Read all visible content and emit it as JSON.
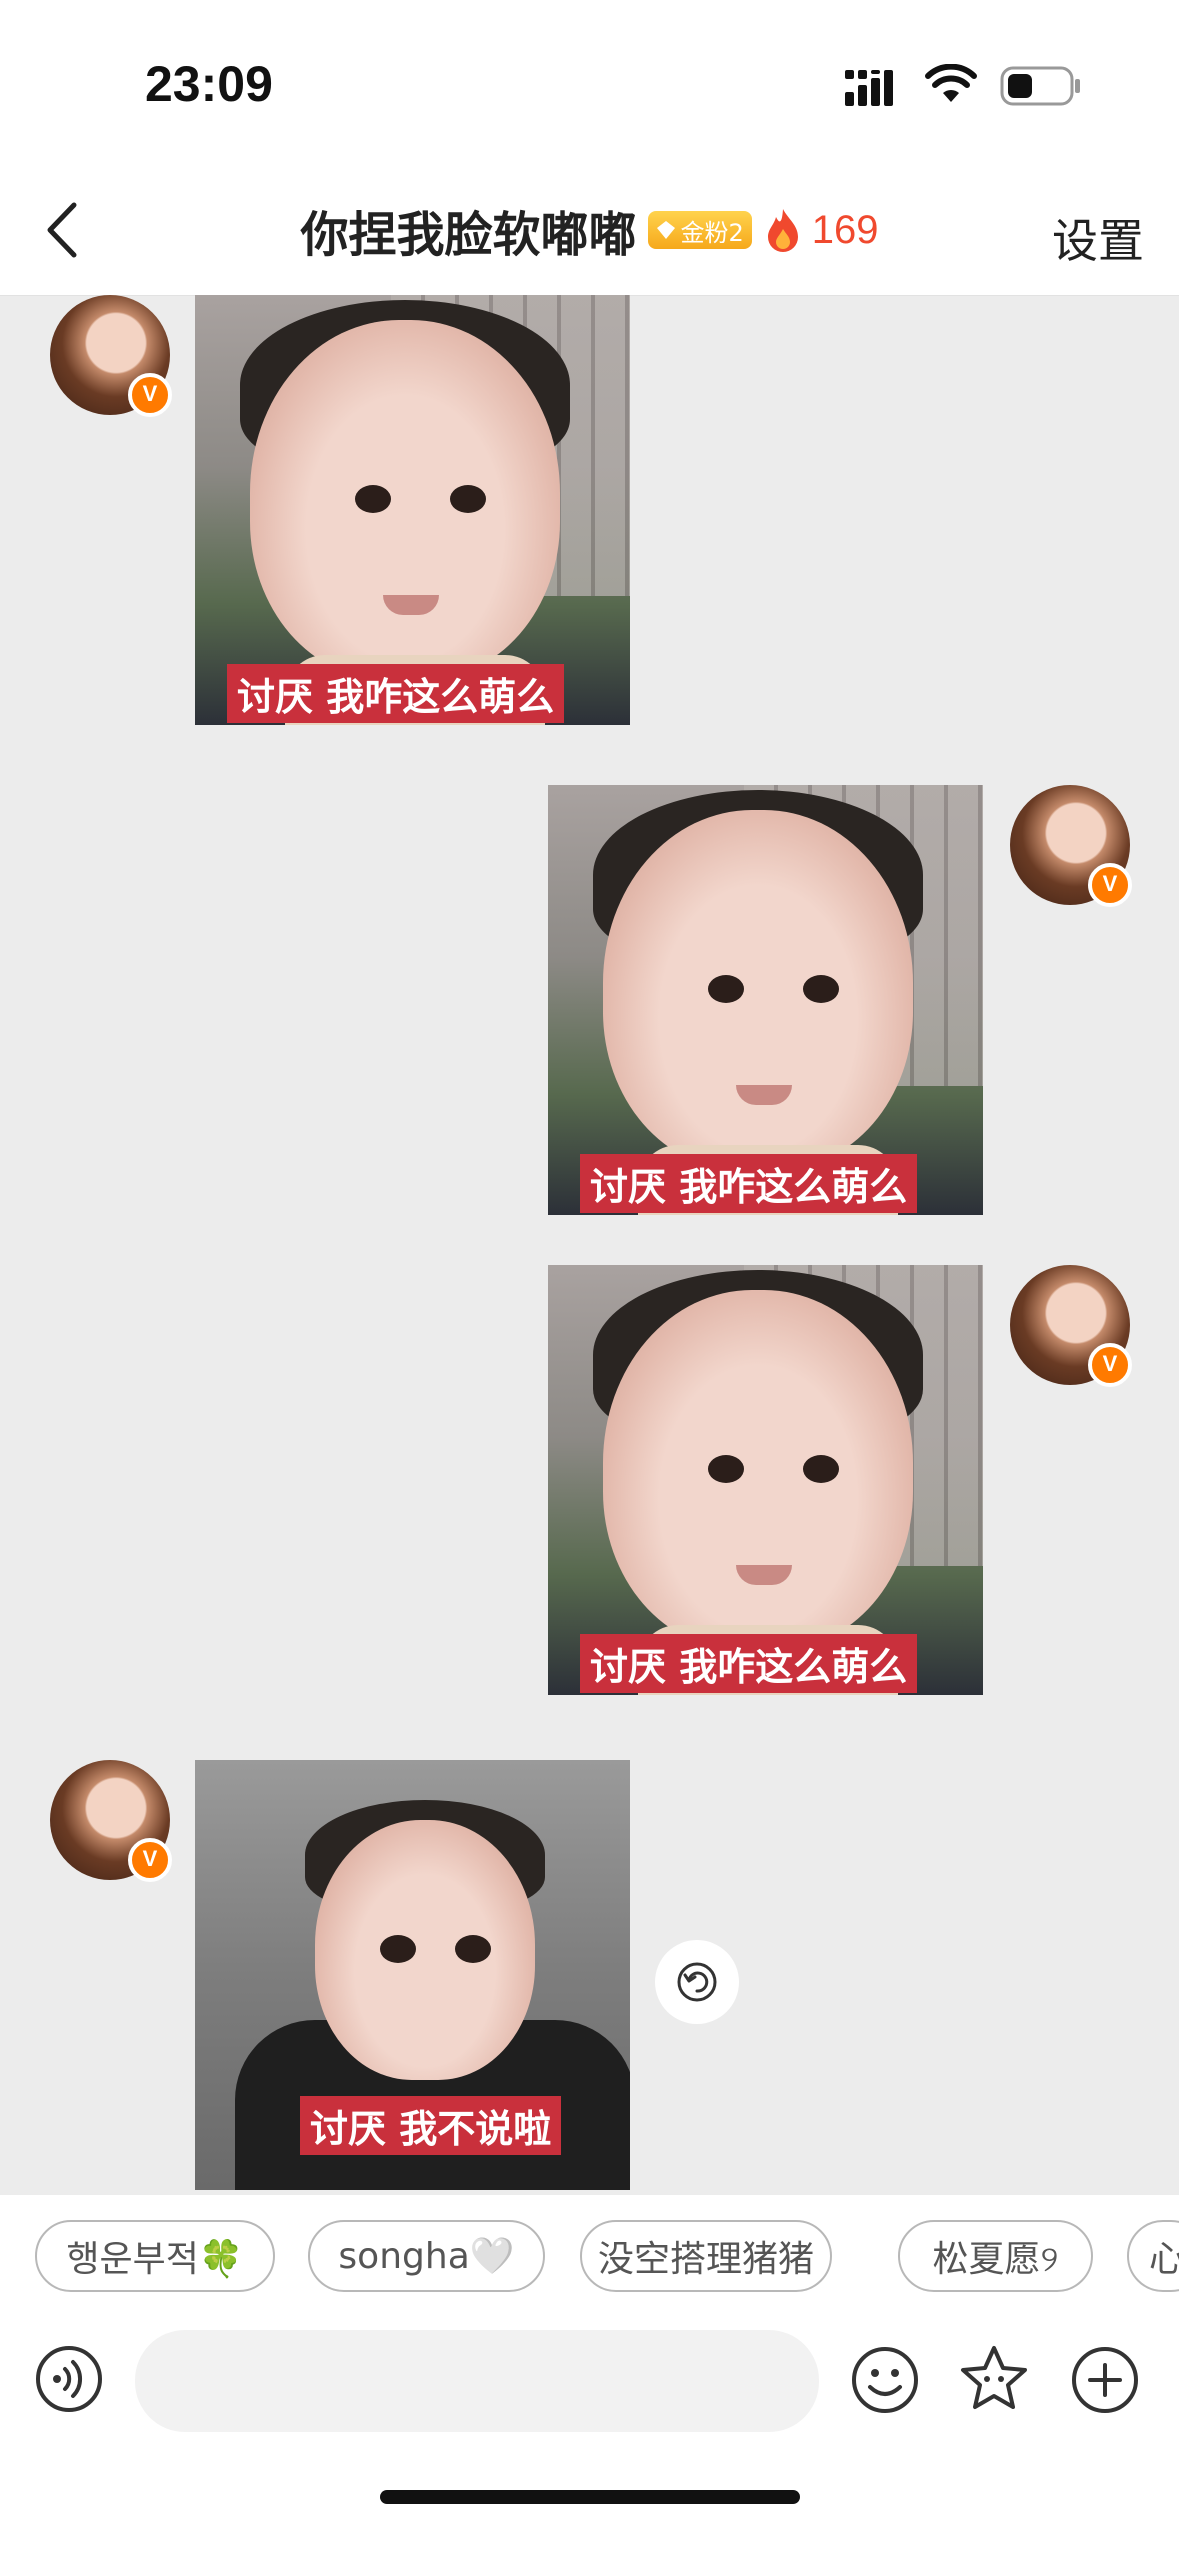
{
  "status_bar": {
    "time": "23:09",
    "icons": [
      "signal-icon",
      "wifi-icon",
      "battery-icon"
    ]
  },
  "header": {
    "title": "你捏我脸软嘟嘟",
    "fan_badge": "金粉2",
    "fire_count": "169",
    "settings_label": "设置",
    "colors": {
      "fire": "#f0492e",
      "badge": "#f6a81b"
    }
  },
  "messages": [
    {
      "sender": "other",
      "caption": "讨厌 我咋这么萌么"
    },
    {
      "sender": "self",
      "caption": "讨厌 我咋这么萌么"
    },
    {
      "sender": "self",
      "caption": "讨厌 我咋这么萌么"
    },
    {
      "sender": "other",
      "caption": "讨厌 我不说啦"
    }
  ],
  "quick_chips": [
    "행운부적🍀",
    "songha🤍",
    "没空搭理猪猪",
    "松夏愿୨",
    "心"
  ],
  "input": {
    "placeholder": ""
  },
  "avatar_badge": "V"
}
